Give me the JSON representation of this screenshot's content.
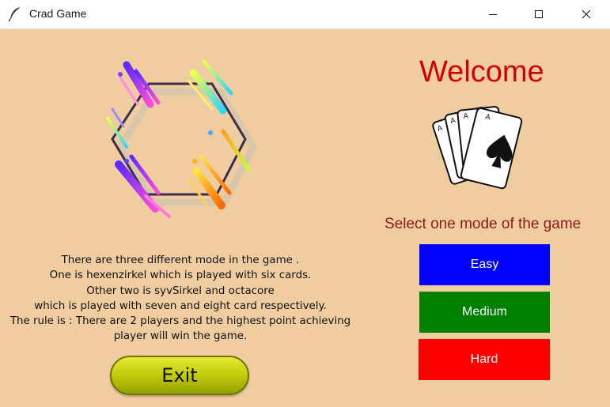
{
  "window": {
    "title": "Crad Game",
    "icons": {
      "app": "feather-icon",
      "minimize": "minimize-icon",
      "maximize": "maximize-icon",
      "close": "close-icon"
    }
  },
  "main": {
    "welcome": "Welcome",
    "cards_icon": "playing-cards-icon",
    "logo": "hexagon-logo",
    "select_mode": "Select one mode of the game",
    "modes": [
      {
        "label": "Easy",
        "color": "#0000ff"
      },
      {
        "label": "Medium",
        "color": "#008000"
      },
      {
        "label": "Hard",
        "color": "#ff0000"
      }
    ],
    "description": [
      "There are three different mode in the game .",
      "One is hexenzirkel which is played with six cards.",
      "Other two is syvSirkel and octacore",
      "which is played with seven and eight card respectively.",
      "The rule is : There are 2 players and the highest point achieving",
      "player will win the game."
    ],
    "exit_label": "Exit"
  },
  "colors": {
    "background": "#efcda0",
    "welcome_text": "#d30000",
    "select_text": "#8b1a1a",
    "exit_button": "#c4cf0c"
  }
}
